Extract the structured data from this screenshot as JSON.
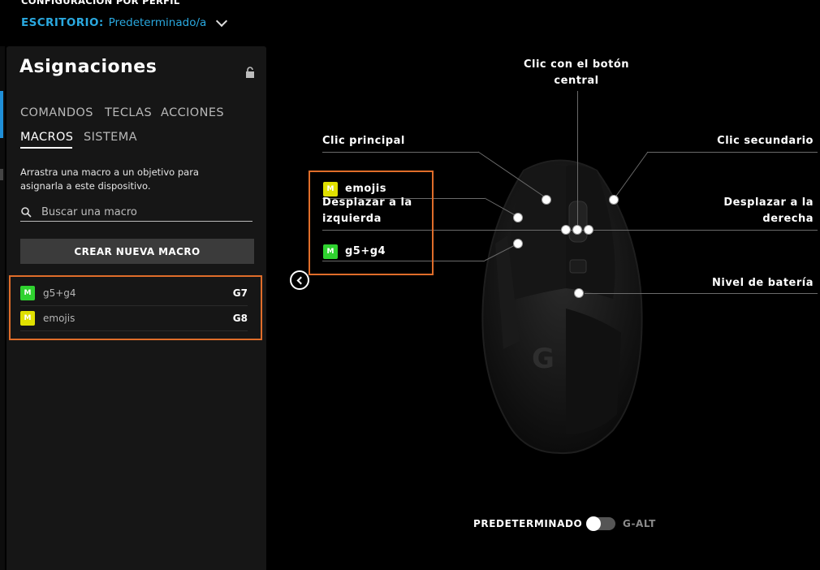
{
  "header": {
    "title": "CONFIGURACIÓN POR PERFIL",
    "profile_key": "ESCRITORIO:",
    "profile_value": "Predeterminado/a"
  },
  "panel": {
    "title": "Asignaciones",
    "tabs": [
      {
        "label": "COMANDOS",
        "active": false
      },
      {
        "label": "TECLAS",
        "active": false
      },
      {
        "label": "ACCIONES",
        "active": false
      },
      {
        "label": "MACROS",
        "active": true
      },
      {
        "label": "SISTEMA",
        "active": false
      }
    ],
    "hint": "Arrastra una macro a un objetivo para asignarla a este dispositivo.",
    "search_placeholder": "Buscar una macro",
    "create_button": "CREAR NUEVA MACRO",
    "macros": [
      {
        "name": "g5+g4",
        "key": "G7",
        "badge": "M",
        "color": "#2fd22f"
      },
      {
        "name": "emojis",
        "key": "G8",
        "badge": "M",
        "color": "#e0e000"
      }
    ]
  },
  "mouse": {
    "labels": {
      "middle_click": "Clic con el botón central",
      "primary_click": "Clic principal",
      "secondary_click": "Clic secundario",
      "scroll_left": "Desplazar a la izquierda",
      "scroll_right": "Desplazar a la derecha",
      "battery": "Nivel de batería"
    },
    "assigned": [
      {
        "name": "emojis",
        "badge": "M",
        "color": "#e0e000"
      },
      {
        "name": "g5+g4",
        "badge": "M",
        "color": "#2fd22f"
      }
    ],
    "logo_icon": "logitech-g-icon"
  },
  "mode_toggle": {
    "left_label": "PREDETERMINADO",
    "right_label": "G-ALT",
    "state": "PREDETERMINADO"
  },
  "colors": {
    "accent": "#2aa9e0",
    "highlight": "#e06d2a",
    "panel_bg": "#161616"
  }
}
